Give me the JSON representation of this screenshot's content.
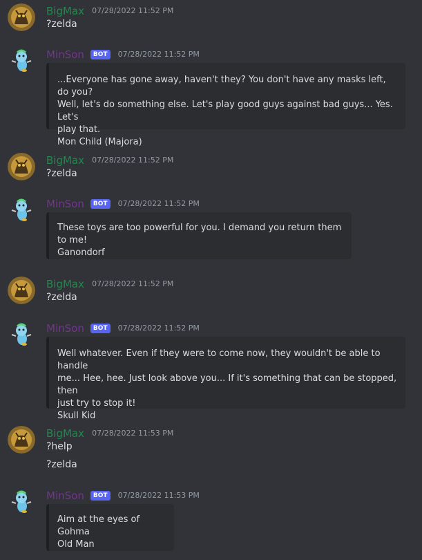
{
  "colors": {
    "background": "#313338",
    "user_name": "#1f8b4c",
    "bot_name": "#71368a",
    "badge": "#5865f2",
    "embed_bg": "#2b2d31"
  },
  "users": {
    "bigmax": {
      "name": "BigMax",
      "avatar_icon": "fantasy-creature-avatar"
    },
    "minson": {
      "name": "MinSon",
      "badge": "BOT",
      "avatar_icon": "blue-mascot-avatar"
    }
  },
  "messages": [
    {
      "author": "BigMax",
      "timestamp": "07/28/2022 11:52 PM",
      "lines": [
        "?zelda"
      ]
    },
    {
      "author": "MinSon",
      "badge": "BOT",
      "timestamp": "07/28/2022 11:52 PM",
      "embed": {
        "lines": [
          "...Everyone has gone away, haven't they? You don't have any masks left, do you?",
          "Well, let's do something else. Let's play good guys against bad guys... Yes. Let's",
          "play that."
        ],
        "source": "Mon Child (Majora)"
      }
    },
    {
      "author": "BigMax",
      "timestamp": "07/28/2022 11:52 PM",
      "lines": [
        "?zelda"
      ]
    },
    {
      "author": "MinSon",
      "badge": "BOT",
      "timestamp": "07/28/2022 11:52 PM",
      "embed": {
        "lines": [
          "These toys are too powerful for you. I demand you return them to me!"
        ],
        "source": "Ganondorf"
      }
    },
    {
      "author": "BigMax",
      "timestamp": "07/28/2022 11:52 PM",
      "lines": [
        "?zelda"
      ]
    },
    {
      "author": "MinSon",
      "badge": "BOT",
      "timestamp": "07/28/2022 11:52 PM",
      "embed": {
        "lines": [
          "Well whatever. Even if they were to come now, they wouldn't be able to handle",
          "me... Hee, hee. Just look above you... If it's something that can be stopped, then",
          "just try to stop it!"
        ],
        "source": "Skull Kid"
      }
    },
    {
      "author": "BigMax",
      "timestamp": "07/28/2022 11:53 PM",
      "lines": [
        "?help",
        "?zelda"
      ]
    },
    {
      "author": "MinSon",
      "badge": "BOT",
      "timestamp": "07/28/2022 11:53 PM",
      "embed": {
        "lines": [
          "Aim at the eyes of Gohma"
        ],
        "source": "Old Man"
      }
    }
  ]
}
